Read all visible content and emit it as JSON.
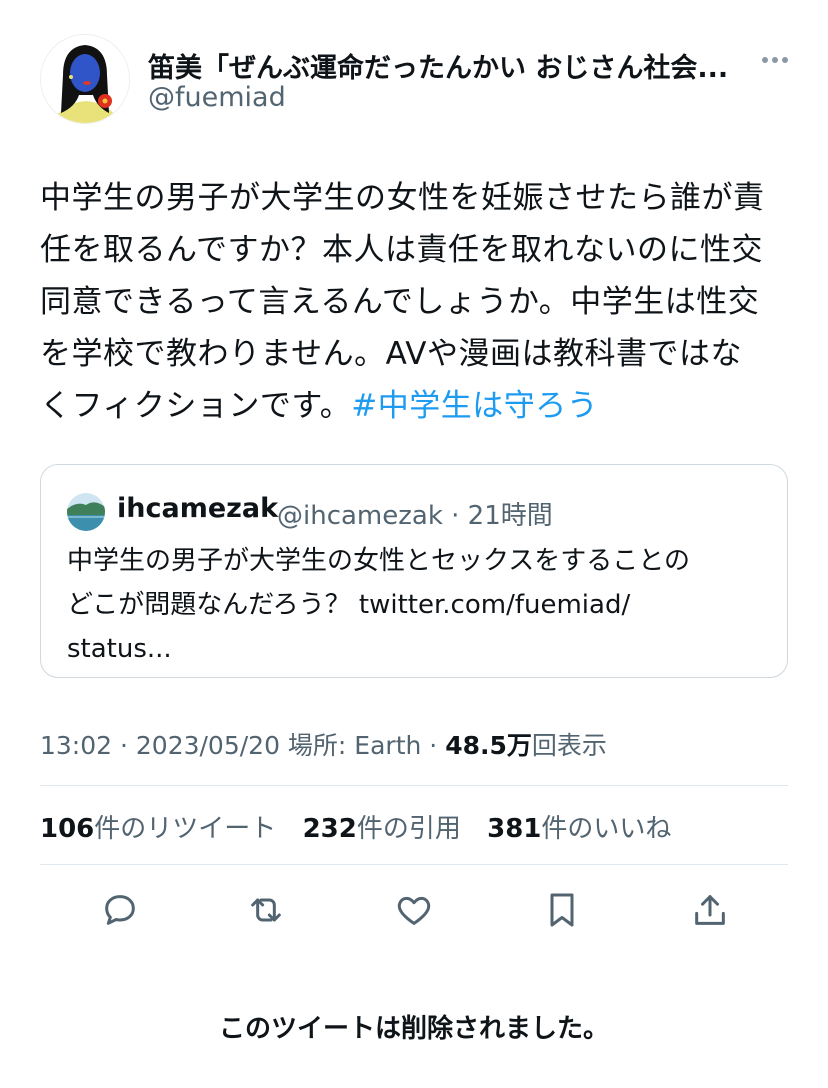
{
  "author": {
    "name": "笛美「ぜんぶ運命だったんかい おじさん社会...",
    "handle": "@fuemiad"
  },
  "tweet": {
    "lines": [
      "中学生の男子が大学生の女性を妊娠させたら誰が責",
      "任を取るんですか？本人は責任を取れないのに性交",
      "同意できるって言えるんでしょうか。中学生は性交",
      "を学校で教わりません。AVや漫画は教科書ではな",
      "くフィクションです。"
    ],
    "hashtag": "#中学生は守ろう"
  },
  "quote": {
    "name": "ihcamezak",
    "meta": "@ihcamezak · 21時間",
    "lines": [
      "中学生の男子が大学生の女性とセックスをすることの",
      "どこが問題なんだろう？ twitter.com/fuemiad/",
      "status..."
    ]
  },
  "meta": {
    "time_date_place": "13:02 · 2023/05/20 場所: Earth · ",
    "views_count": "48.5万",
    "views_label": "回表示"
  },
  "stats": {
    "retweets_count": "106",
    "retweets_label": "件のリツイート",
    "quotes_count": "232",
    "quotes_label": "件の引用",
    "likes_count": "381",
    "likes_label": "件のいいね"
  },
  "deleted_notice": "このツイートは削除されました。",
  "colors": {
    "accent": "#1d9bf0",
    "secondary_text": "#536471",
    "icon": "#536471"
  },
  "icons": [
    "reply-icon",
    "retweet-icon",
    "like-icon",
    "bookmark-icon",
    "share-icon"
  ]
}
